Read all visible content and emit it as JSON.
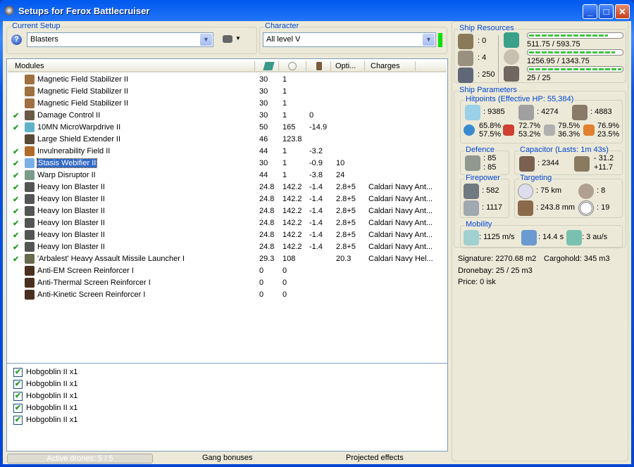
{
  "window": {
    "title": "Setups for Ferox Battlecruiser",
    "buttons": [
      "minimize",
      "maximize",
      "close"
    ]
  },
  "setup": {
    "label": "Current Setup",
    "value": "Blasters",
    "help_icon": "question-icon",
    "fitting_icon": "ship-icon"
  },
  "character": {
    "label": "Character",
    "value": "All level V",
    "status_color": "#00e000"
  },
  "modules": {
    "headers": [
      "Modules",
      "cpu-icon",
      "powergrid-icon",
      "capacitor-icon",
      "Opti...",
      "Charges"
    ],
    "rows": [
      {
        "active": false,
        "name": "Magnetic Field Stabilizer II",
        "cpu": "30",
        "pg": "1",
        "cap": "",
        "opt": "",
        "charge": "",
        "color": "#a07040"
      },
      {
        "active": false,
        "name": "Magnetic Field Stabilizer II",
        "cpu": "30",
        "pg": "1",
        "cap": "",
        "opt": "",
        "charge": "",
        "color": "#a07040"
      },
      {
        "active": false,
        "name": "Magnetic Field Stabilizer II",
        "cpu": "30",
        "pg": "1",
        "cap": "",
        "opt": "",
        "charge": "",
        "color": "#a07040"
      },
      {
        "active": true,
        "name": "Damage Control II",
        "cpu": "30",
        "pg": "1",
        "cap": "0",
        "opt": "",
        "charge": "",
        "color": "#6a5a48"
      },
      {
        "active": true,
        "name": "10MN MicroWarpdrive II",
        "cpu": "50",
        "pg": "165",
        "cap": "-14.9",
        "opt": "",
        "charge": "",
        "color": "#5fb3c8"
      },
      {
        "active": false,
        "name": "Large Shield Extender II",
        "cpu": "46",
        "pg": "123.8",
        "cap": "",
        "opt": "",
        "charge": "",
        "color": "#5a4a3a"
      },
      {
        "active": true,
        "name": "Invulnerability Field II",
        "cpu": "44",
        "pg": "1",
        "cap": "-3.2",
        "opt": "",
        "charge": "",
        "color": "#b06a2a"
      },
      {
        "active": true,
        "name": "Stasis Webifier II",
        "cpu": "30",
        "pg": "1",
        "cap": "-0.9",
        "opt": "10",
        "charge": "",
        "color": "#7ab0e8",
        "selected": true
      },
      {
        "active": true,
        "name": "Warp Disruptor II",
        "cpu": "44",
        "pg": "1",
        "cap": "-3.8",
        "opt": "24",
        "charge": "",
        "color": "#7a9a8a"
      },
      {
        "active": true,
        "name": "Heavy Ion Blaster II",
        "cpu": "24.8",
        "pg": "142.2",
        "cap": "-1.4",
        "opt": "2.8+5",
        "charge": "Caldari Navy Ant...",
        "color": "#555"
      },
      {
        "active": true,
        "name": "Heavy Ion Blaster II",
        "cpu": "24.8",
        "pg": "142.2",
        "cap": "-1.4",
        "opt": "2.8+5",
        "charge": "Caldari Navy Ant...",
        "color": "#555"
      },
      {
        "active": true,
        "name": "Heavy Ion Blaster II",
        "cpu": "24.8",
        "pg": "142.2",
        "cap": "-1.4",
        "opt": "2.8+5",
        "charge": "Caldari Navy Ant...",
        "color": "#555"
      },
      {
        "active": true,
        "name": "Heavy Ion Blaster II",
        "cpu": "24.8",
        "pg": "142.2",
        "cap": "-1.4",
        "opt": "2.8+5",
        "charge": "Caldari Navy Ant...",
        "color": "#555"
      },
      {
        "active": true,
        "name": "Heavy Ion Blaster II",
        "cpu": "24.8",
        "pg": "142.2",
        "cap": "-1.4",
        "opt": "2.8+5",
        "charge": "Caldari Navy Ant...",
        "color": "#555"
      },
      {
        "active": true,
        "name": "Heavy Ion Blaster II",
        "cpu": "24.8",
        "pg": "142.2",
        "cap": "-1.4",
        "opt": "2.8+5",
        "charge": "Caldari Navy Ant...",
        "color": "#555"
      },
      {
        "active": true,
        "name": "'Arbalest' Heavy Assault Missile Launcher I",
        "cpu": "29.3",
        "pg": "108",
        "cap": "",
        "opt": "20.3",
        "charge": "Caldari Navy Hel...",
        "color": "#6a6a50"
      },
      {
        "active": false,
        "name": "Anti-EM Screen Reinforcer I",
        "cpu": "0",
        "pg": "0",
        "cap": "",
        "opt": "",
        "charge": "",
        "color": "#4a3020"
      },
      {
        "active": false,
        "name": "Anti-Thermal Screen Reinforcer I",
        "cpu": "0",
        "pg": "0",
        "cap": "",
        "opt": "",
        "charge": "",
        "color": "#4a3020"
      },
      {
        "active": false,
        "name": "Anti-Kinetic Screen Reinforcer I",
        "cpu": "0",
        "pg": "0",
        "cap": "",
        "opt": "",
        "charge": "",
        "color": "#4a3020"
      }
    ]
  },
  "drones": {
    "items": [
      "Hobgoblin II x1",
      "Hobgoblin II x1",
      "Hobgoblin II x1",
      "Hobgoblin II x1",
      "Hobgoblin II x1"
    ]
  },
  "bottom": {
    "active_drones": "Active drones: 5 / 5",
    "gang": "Gang bonuses",
    "projected": "Projected effects"
  },
  "resources": {
    "label": "Ship Resources",
    "turrets": ": 0",
    "launchers": ": 4",
    "calibration": ": 250",
    "cpu": {
      "text": "511.75 / 593.75",
      "fraction": 0.862
    },
    "powergrid": {
      "text": "1256.95 / 1343.75",
      "fraction": 0.935
    },
    "drone_bandwidth": {
      "text": "25 / 25",
      "fraction": 1.0
    }
  },
  "params": {
    "label": "Ship Parameters",
    "hitpoints": {
      "label": "Hitpoints (Effective HP: 55,384)",
      "shield": ": 9385",
      "armor": ": 4274",
      "structure": ": 4883",
      "em": [
        "65.8%",
        "57.5%"
      ],
      "thermal": [
        "72.7%",
        "53.2%"
      ],
      "kinetic": [
        "79.5%",
        "36.3%"
      ],
      "explosive": [
        "76.9%",
        "23.5%"
      ]
    },
    "defence": {
      "label": "Defence",
      "a": ": 85",
      "b": ": 85"
    },
    "capacitor": {
      "label": "Capacitor (Lasts: 1m 43s)",
      "capacity": ": 2344",
      "use": "- 31.2",
      "recharge": "+11.7"
    },
    "firepower": {
      "label": "Firepower",
      "dps": ": 582",
      "volley": ": 1117"
    },
    "targeting": {
      "label": "Targeting",
      "range": ": 75 km",
      "max_targets": ": 8",
      "resolution": ": 243.8 mm",
      "sensor": ": 19"
    },
    "mobility": {
      "label": "Mobility",
      "speed": ": 1125 m/s",
      "align": ": 14.4 s",
      "warp": ": 3 au/s"
    },
    "signature": "Signature: 2270.68 m2",
    "cargo": "Cargohold: 345 m3",
    "dronebay": "Dronebay: 25 / 25 m3",
    "price": "Price: 0 isk"
  }
}
